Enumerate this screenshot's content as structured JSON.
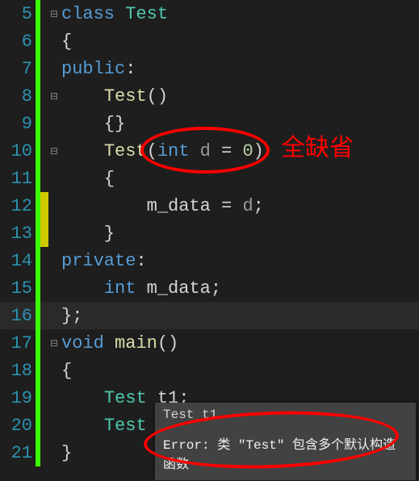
{
  "lines": [
    {
      "num": 5,
      "fold": "⊟",
      "mark": "",
      "tokens": [
        [
          "kw",
          "class"
        ],
        [
          "punct",
          " "
        ],
        [
          "type",
          "Test"
        ]
      ]
    },
    {
      "num": 6,
      "fold": "",
      "mark": "",
      "tokens": [
        [
          "punct",
          "{"
        ]
      ]
    },
    {
      "num": 7,
      "fold": "",
      "mark": "",
      "tokens": [
        [
          "kw",
          "public"
        ],
        [
          "punct",
          ":"
        ]
      ]
    },
    {
      "num": 8,
      "fold": "⊟",
      "mark": "",
      "tokens": [
        [
          "punct",
          "    "
        ],
        [
          "func",
          "Test"
        ],
        [
          "punct",
          "()"
        ]
      ]
    },
    {
      "num": 9,
      "fold": "",
      "mark": "",
      "tokens": [
        [
          "punct",
          "    {}"
        ]
      ]
    },
    {
      "num": 10,
      "fold": "⊟",
      "mark": "",
      "tokens": [
        [
          "punct",
          "    "
        ],
        [
          "func",
          "Test"
        ],
        [
          "punct",
          "("
        ],
        [
          "kw",
          "int"
        ],
        [
          "punct",
          " "
        ],
        [
          "param",
          "d"
        ],
        [
          "punct",
          " = "
        ],
        [
          "num",
          "0"
        ],
        [
          "punct",
          ")"
        ]
      ]
    },
    {
      "num": 11,
      "fold": "",
      "mark": "",
      "tokens": [
        [
          "punct",
          "    {"
        ]
      ]
    },
    {
      "num": 12,
      "fold": "",
      "mark": "mod",
      "tokens": [
        [
          "punct",
          "        "
        ],
        [
          "var",
          "m_data"
        ],
        [
          "punct",
          " = "
        ],
        [
          "param",
          "d"
        ],
        [
          "punct",
          ";"
        ]
      ]
    },
    {
      "num": 13,
      "fold": "",
      "mark": "mod",
      "tokens": [
        [
          "punct",
          "    }"
        ]
      ]
    },
    {
      "num": 14,
      "fold": "",
      "mark": "",
      "tokens": [
        [
          "kw",
          "private"
        ],
        [
          "punct",
          ":"
        ]
      ]
    },
    {
      "num": 15,
      "fold": "",
      "mark": "",
      "tokens": [
        [
          "punct",
          "    "
        ],
        [
          "kw",
          "int"
        ],
        [
          "punct",
          " "
        ],
        [
          "var",
          "m_data"
        ],
        [
          "punct",
          ";"
        ]
      ]
    },
    {
      "num": 16,
      "fold": "",
      "mark": "",
      "tokens": [
        [
          "punct",
          "};"
        ]
      ],
      "hl": true
    },
    {
      "num": 17,
      "fold": "⊟",
      "mark": "",
      "tokens": [
        [
          "kw",
          "void"
        ],
        [
          "punct",
          " "
        ],
        [
          "func",
          "main"
        ],
        [
          "punct",
          "()"
        ]
      ]
    },
    {
      "num": 18,
      "fold": "",
      "mark": "",
      "tokens": [
        [
          "punct",
          "{"
        ]
      ]
    },
    {
      "num": 19,
      "fold": "",
      "mark": "",
      "tokens": [
        [
          "punct",
          "    "
        ],
        [
          "type",
          "Test"
        ],
        [
          "punct",
          " "
        ],
        [
          "sq",
          "t1"
        ],
        [
          "punct",
          ";"
        ]
      ]
    },
    {
      "num": 20,
      "fold": "",
      "mark": "",
      "tokens": [
        [
          "punct",
          "    "
        ],
        [
          "type",
          "Test"
        ],
        [
          "punct",
          " "
        ]
      ]
    },
    {
      "num": 21,
      "fold": "",
      "mark": "",
      "tokens": [
        [
          "punct",
          "}"
        ]
      ]
    }
  ],
  "annotation": {
    "label": "全缺省"
  },
  "tooltip": {
    "signature": "Test t1",
    "error": "Error: 类 \"Test\" 包含多个默认构造函数"
  }
}
